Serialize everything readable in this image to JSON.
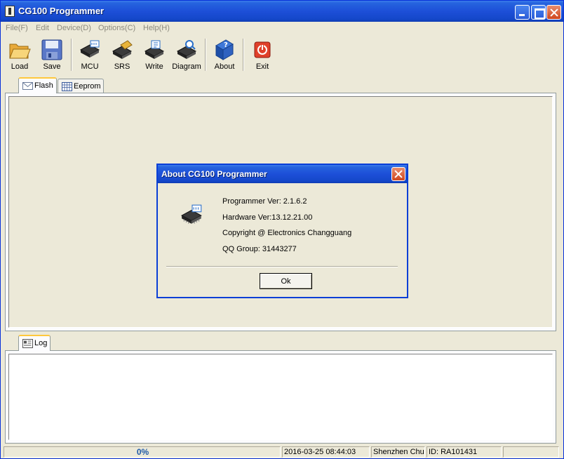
{
  "window": {
    "title": "CG100 Programmer"
  },
  "menu": [
    {
      "label": "File(F)"
    },
    {
      "label": "Edit"
    },
    {
      "label": "Device(D)"
    },
    {
      "label": "Options(C)"
    },
    {
      "label": "Help(H)"
    }
  ],
  "toolbar": {
    "load": "Load",
    "save": "Save",
    "mcu": "MCU",
    "srs": "SRS",
    "write": "Write",
    "diagram": "Diagram",
    "about": "About",
    "exit": "Exit"
  },
  "tabs": {
    "flash": "Flash",
    "eeprom": "Eeprom",
    "log": "Log"
  },
  "dialog": {
    "title": "About CG100 Programmer",
    "programmer_ver": "Programmer Ver: 2.1.6.2",
    "hardware_ver": "Hardware Ver:13.12.21.00",
    "copyright": "Copyright @ Electronics Changguang",
    "qq_group": "QQ Group: 31443277",
    "ok_label": "Ok"
  },
  "status": {
    "progress": "0%",
    "progress_value": 0,
    "datetime": "2016-03-25 08:44:03",
    "company": "Shenzhen Chua",
    "id": "ID: RA101431"
  },
  "colors": {
    "titlebar": "#1D4FD8",
    "face": "#ECE9D8",
    "progress_text": "#1F5AA8",
    "tab_highlight": "#FFC83C"
  }
}
